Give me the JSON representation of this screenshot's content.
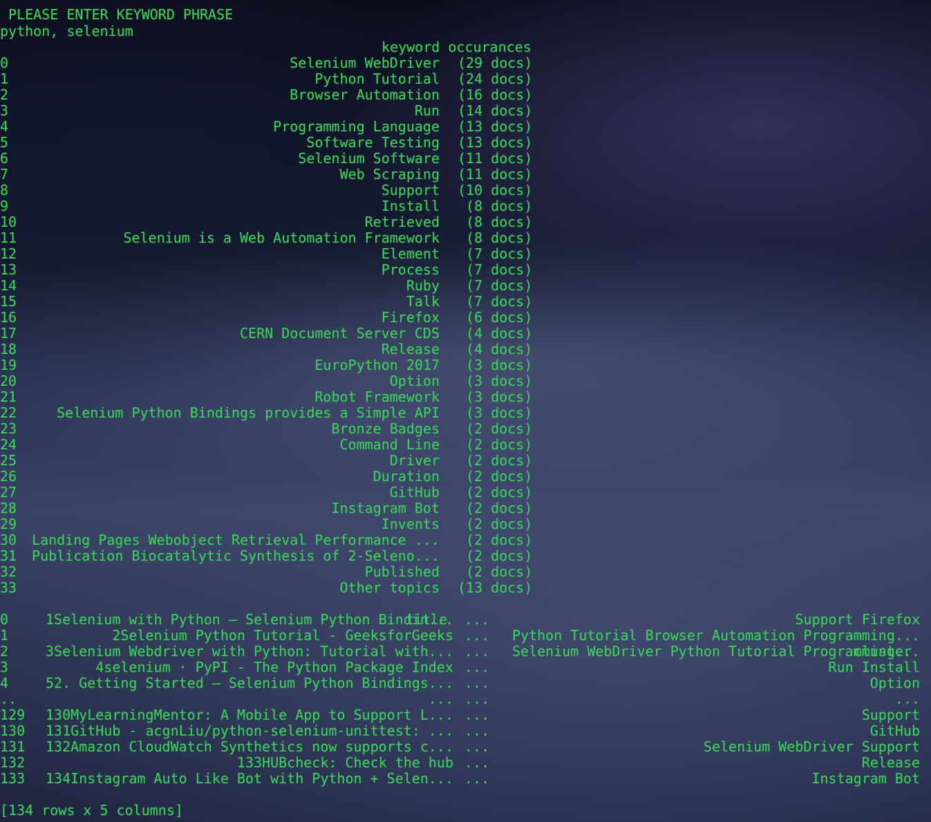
{
  "prompt": " PLEASE ENTER KEYWORD PHRASE",
  "input_value": "python, selenium",
  "keyword_table": {
    "header": "keyword occurances",
    "rows": [
      {
        "index": "0",
        "keyword": "Selenium WebDriver",
        "docs": "(29 docs)"
      },
      {
        "index": "1",
        "keyword": "Python Tutorial",
        "docs": "(24 docs)"
      },
      {
        "index": "2",
        "keyword": "Browser Automation",
        "docs": "(16 docs)"
      },
      {
        "index": "3",
        "keyword": "Run",
        "docs": "(14 docs)"
      },
      {
        "index": "4",
        "keyword": "Programming Language",
        "docs": "(13 docs)"
      },
      {
        "index": "5",
        "keyword": "Software Testing",
        "docs": "(13 docs)"
      },
      {
        "index": "6",
        "keyword": "Selenium Software",
        "docs": "(11 docs)"
      },
      {
        "index": "7",
        "keyword": "Web Scraping",
        "docs": "(11 docs)"
      },
      {
        "index": "8",
        "keyword": "Support",
        "docs": "(10 docs)"
      },
      {
        "index": "9",
        "keyword": "Install",
        "docs": " (8 docs)"
      },
      {
        "index": "10",
        "keyword": "Retrieved",
        "docs": " (8 docs)"
      },
      {
        "index": "11",
        "keyword": "Selenium is a Web Automation Framework",
        "docs": " (8 docs)"
      },
      {
        "index": "12",
        "keyword": "Element",
        "docs": " (7 docs)"
      },
      {
        "index": "13",
        "keyword": "Process",
        "docs": " (7 docs)"
      },
      {
        "index": "14",
        "keyword": "Ruby",
        "docs": " (7 docs)"
      },
      {
        "index": "15",
        "keyword": "Talk",
        "docs": " (7 docs)"
      },
      {
        "index": "16",
        "keyword": "Firefox",
        "docs": " (6 docs)"
      },
      {
        "index": "17",
        "keyword": "CERN Document Server CDS",
        "docs": " (4 docs)"
      },
      {
        "index": "18",
        "keyword": "Release",
        "docs": " (4 docs)"
      },
      {
        "index": "19",
        "keyword": "EuroPython 2017",
        "docs": " (3 docs)"
      },
      {
        "index": "20",
        "keyword": "Option",
        "docs": " (3 docs)"
      },
      {
        "index": "21",
        "keyword": "Robot Framework",
        "docs": " (3 docs)"
      },
      {
        "index": "22",
        "keyword": "Selenium Python Bindings provides a Simple API",
        "docs": " (3 docs)"
      },
      {
        "index": "23",
        "keyword": "Bronze Badges",
        "docs": " (2 docs)"
      },
      {
        "index": "24",
        "keyword": "Command Line",
        "docs": " (2 docs)"
      },
      {
        "index": "25",
        "keyword": "Driver",
        "docs": " (2 docs)"
      },
      {
        "index": "26",
        "keyword": "Duration",
        "docs": " (2 docs)"
      },
      {
        "index": "27",
        "keyword": "GitHub",
        "docs": " (2 docs)"
      },
      {
        "index": "28",
        "keyword": "Instagram Bot",
        "docs": " (2 docs)"
      },
      {
        "index": "29",
        "keyword": "Invents",
        "docs": " (2 docs)"
      },
      {
        "index": "30",
        "keyword": "Landing Pages Webobject Retrieval Performance ...",
        "docs": " (2 docs)"
      },
      {
        "index": "31",
        "keyword": "Publication Biocatalytic Synthesis of 2-Seleno...",
        "docs": " (2 docs)"
      },
      {
        "index": "32",
        "keyword": "Published",
        "docs": " (2 docs)"
      },
      {
        "index": "33",
        "keyword": "Other topics",
        "docs": "(13 docs)"
      }
    ]
  },
  "results_table": {
    "header_title": "title",
    "header_dots": "...",
    "header_cluster": "cluster",
    "rows": [
      {
        "index": "0",
        "title": "1Selenium with Python — Selenium Python Bindin...",
        "dots": "...",
        "cluster": "Support Firefox"
      },
      {
        "index": "1",
        "title": "2Selenium Python Tutorial - GeeksforGeeks",
        "dots": "...",
        "cluster": "Python Tutorial Browser Automation Programming..."
      },
      {
        "index": "2",
        "title": "3Selenium Webdriver with Python: Tutorial with...",
        "dots": "...",
        "cluster": "Selenium WebDriver Python Tutorial Programming..."
      },
      {
        "index": "3",
        "title": "4selenium · PyPI - The Python Package Index",
        "dots": "...",
        "cluster": "Run Install"
      },
      {
        "index": "4",
        "title": "52. Getting Started — Selenium Python Bindings...",
        "dots": "...",
        "cluster": "Option"
      },
      {
        "index": "..",
        "title": "...",
        "dots": "...",
        "cluster": "..."
      },
      {
        "index": "129",
        "title": "130MyLearningMentor: A Mobile App to Support L...",
        "dots": "...",
        "cluster": "Support"
      },
      {
        "index": "130",
        "title": "131GitHub - acgnLiu/python-selenium-unittest: ...",
        "dots": "...",
        "cluster": "GitHub"
      },
      {
        "index": "131",
        "title": "132Amazon CloudWatch Synthetics now supports c...",
        "dots": "...",
        "cluster": "Selenium WebDriver Support"
      },
      {
        "index": "132",
        "title": "133HUBcheck: Check the hub",
        "dots": "...",
        "cluster": "Release"
      },
      {
        "index": "133",
        "title": "134Instagram Auto Like Bot with Python + Selen...",
        "dots": "...",
        "cluster": "Instagram Bot"
      }
    ]
  },
  "footer": "[134 rows x 5 columns]",
  "colors": {
    "terminal_text": "#3ad35a"
  }
}
